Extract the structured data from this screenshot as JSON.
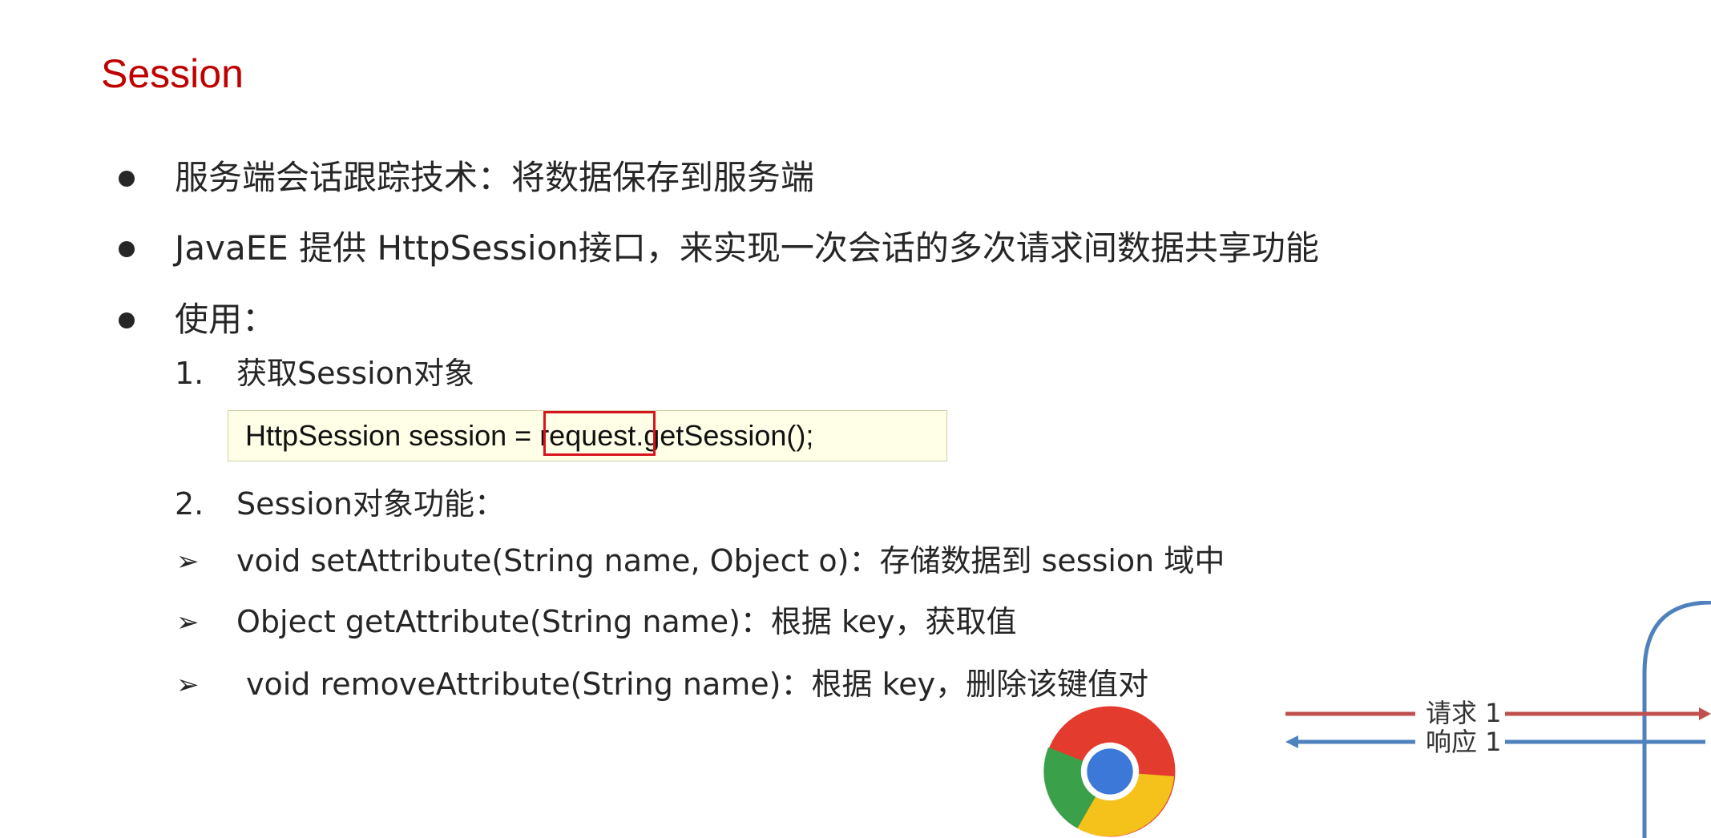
{
  "slide": {
    "title": "Session",
    "bullets": [
      "服务端会话跟踪技术：将数据保存到服务端",
      "JavaEE 提供 HttpSession接口，来实现一次会话的多次请求间数据共享功能",
      "使用："
    ],
    "steps": [
      {
        "num": "1.",
        "text": "获取Session对象"
      },
      {
        "num": "2.",
        "text": "Session对象功能："
      }
    ],
    "code": "HttpSession session = request.getSession();",
    "methods": [
      "void setAttribute(String name, Object o)：存储数据到 session 域中",
      "Object getAttribute(String name)：根据 key，获取值",
      "void removeAttribute(String name)：根据 key，删除该键值对"
    ]
  },
  "diagram": {
    "request_label": "请求 1",
    "response_label": "响应 1",
    "colors": {
      "request": "#c0504d",
      "response": "#4f81bd",
      "server": "#4f81bd"
    }
  },
  "icons": [
    "chrome-browser-icon",
    "arrow-bullet-icon"
  ]
}
